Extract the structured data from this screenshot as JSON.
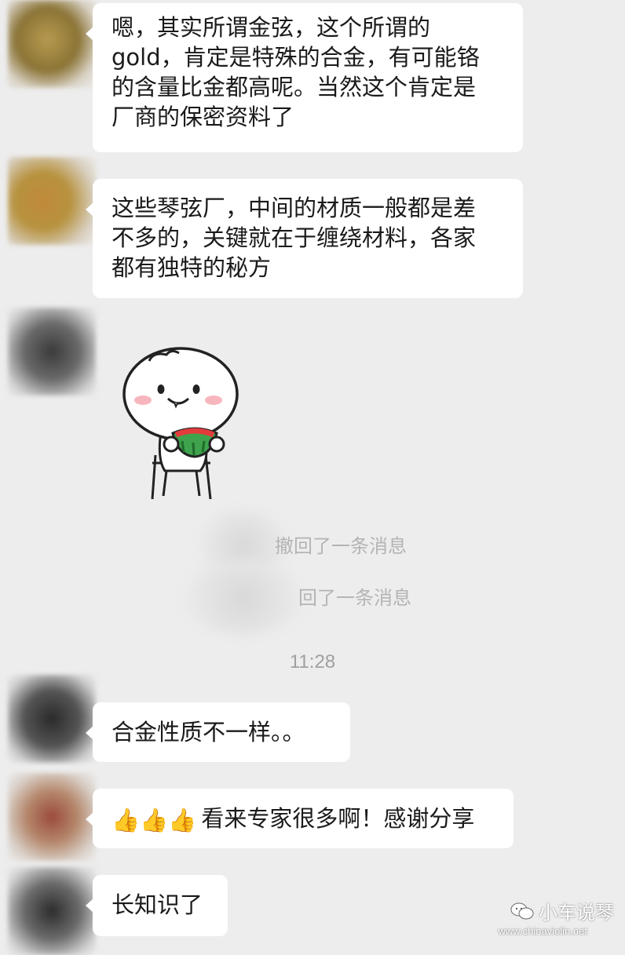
{
  "messages": {
    "m1": {
      "lines": [
        "嗯，其实所谓金弦，这个所谓的",
        "gold，肯定是特殊的合金，有可能铬",
        "的含量比金都高呢。当然这个肯定是",
        "厂商的保密资料了"
      ]
    },
    "m2": {
      "lines": [
        "这些琴弦厂，中间的材质一般都是差",
        "不多的，关键就在于缠绕材料，各家",
        "都有独特的秘方"
      ]
    },
    "m3": {
      "text": "合金性质不一样。。"
    },
    "m4": {
      "emoji": "👍👍👍",
      "text": "看来专家很多啊！感谢分享"
    },
    "m5": {
      "text": "长知识了"
    }
  },
  "system": {
    "recall1": "撤回了一条消息",
    "recall2": "回了一条消息",
    "time": "11:28"
  },
  "watermark": {
    "name": "小车说琴",
    "url": "www.chinaviolin.net"
  },
  "icons": {
    "sticker": "sticker-bun-eating-watermelon",
    "watermark_logo": "wechat-icon"
  }
}
